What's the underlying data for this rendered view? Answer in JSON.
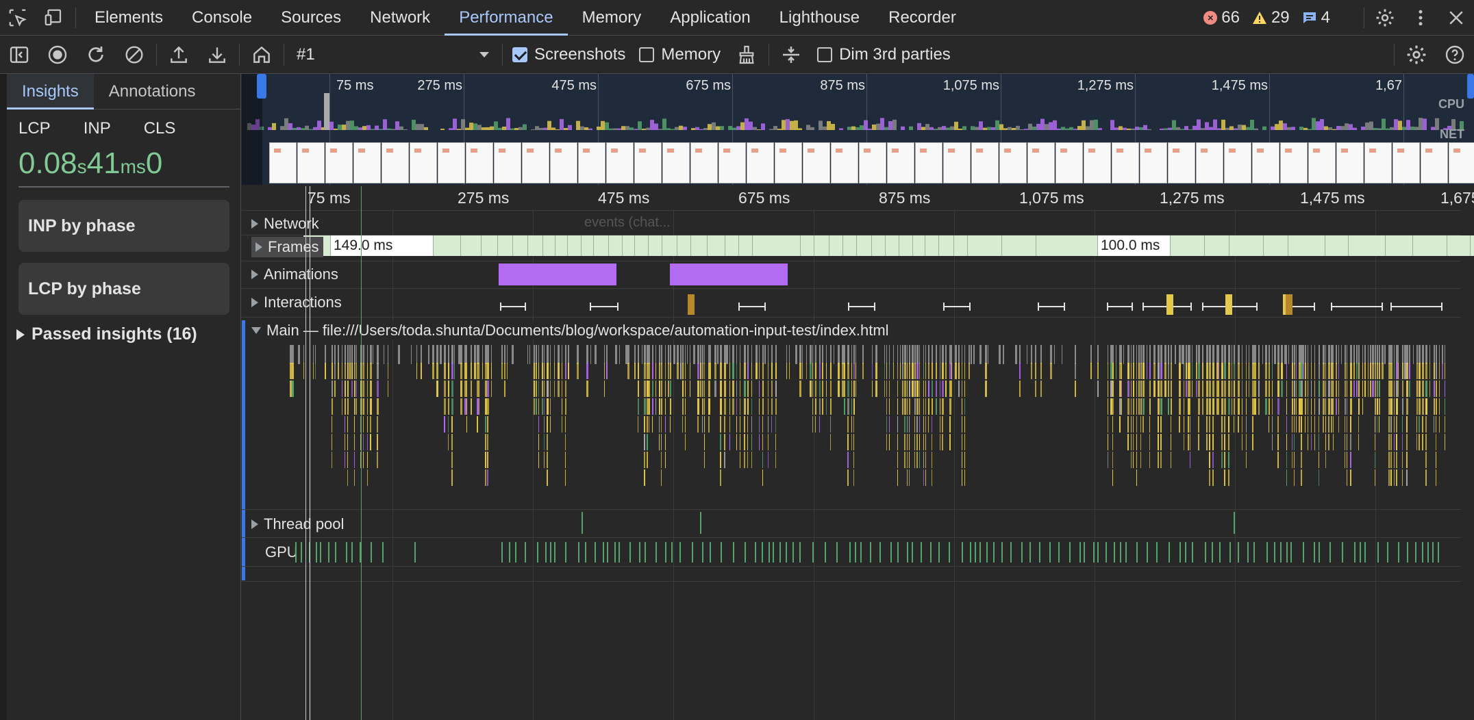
{
  "tabbar": {
    "tabs": [
      "Elements",
      "Console",
      "Sources",
      "Network",
      "Performance",
      "Memory",
      "Application",
      "Lighthouse",
      "Recorder"
    ],
    "active": "Performance",
    "errors": "66",
    "warnings": "29",
    "messages": "4"
  },
  "toolbar": {
    "recording": "#1",
    "screenshots_label": "Screenshots",
    "screenshots_checked": true,
    "memory_label": "Memory",
    "memory_checked": false,
    "dim_label": "Dim 3rd parties",
    "dim_checked": false
  },
  "sidebar": {
    "tabs": [
      "Insights",
      "Annotations"
    ],
    "active": "Insights",
    "metric_labels": [
      "LCP",
      "INP",
      "CLS"
    ],
    "lcp_value": "0.08",
    "lcp_unit": "s",
    "inp_value": "41",
    "inp_unit": "ms",
    "cls_value": "0",
    "cards": [
      "INP by phase",
      "LCP by phase"
    ],
    "passed": "Passed insights (16)"
  },
  "overview": {
    "ticks": [
      "75 ms",
      "275 ms",
      "475 ms",
      "675 ms",
      "875 ms",
      "1,075 ms",
      "1,275 ms",
      "1,475 ms",
      "1,67"
    ],
    "cpu_label": "CPU",
    "net_label": "NET"
  },
  "ruler": {
    "ticks": [
      "75 ms",
      "275 ms",
      "475 ms",
      "675 ms",
      "875 ms",
      "1,075 ms",
      "1,275 ms",
      "1,475 ms",
      "1,675"
    ]
  },
  "tracks": {
    "network": "Network",
    "network_hint": "events (chat...",
    "frames": "Frames",
    "frame_long_1": "149.0 ms",
    "frame_long_2": "100.0 ms",
    "animations": "Animations",
    "interactions": "Interactions",
    "main": "Main — file:///Users/toda.shunta/Documents/blog/workspace/automation-input-test/index.html",
    "thread_pool": "Thread pool",
    "gpu": "GPU"
  },
  "colors": {
    "accent": "#a8c7fa",
    "good": "#81c995",
    "scripting": "#e3c84a",
    "rendering": "#b46bf3",
    "painting": "#54a36c",
    "other": "#8a8a8a"
  }
}
